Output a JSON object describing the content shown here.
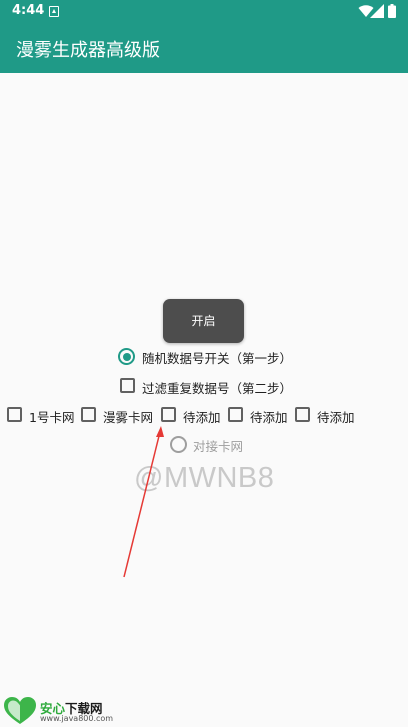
{
  "status_bar": {
    "time": "4:44",
    "icons": [
      "notification-a-icon",
      "wifi-icon",
      "battery-icon"
    ]
  },
  "app_bar": {
    "title": "漫雾生成器高级版",
    "color": "#1f9a87"
  },
  "start_button": {
    "label": "开启"
  },
  "random_data_radio": {
    "label": "随机数据号开关（第一步）",
    "checked": true
  },
  "filter_duplicate_checkbox": {
    "label": "过滤重复数据号（第二步）",
    "checked": false
  },
  "card_options": [
    {
      "label": "1号卡网",
      "checked": false
    },
    {
      "label": "漫雾卡网",
      "checked": false
    },
    {
      "label": "待添加",
      "checked": false
    },
    {
      "label": "待添加",
      "checked": false
    },
    {
      "label": "待添加",
      "checked": false
    }
  ],
  "connect_radio": {
    "label": "对接卡网",
    "checked": false,
    "enabled": false
  },
  "watermark": "@MWNB8",
  "footer": {
    "site_name_part1": "安心",
    "site_name_part2": "下载网",
    "site_url": "www.java800.com"
  },
  "colors": {
    "accent": "#1f9a87",
    "button": "#4d4d4d",
    "annotation_arrow": "#e53935"
  }
}
